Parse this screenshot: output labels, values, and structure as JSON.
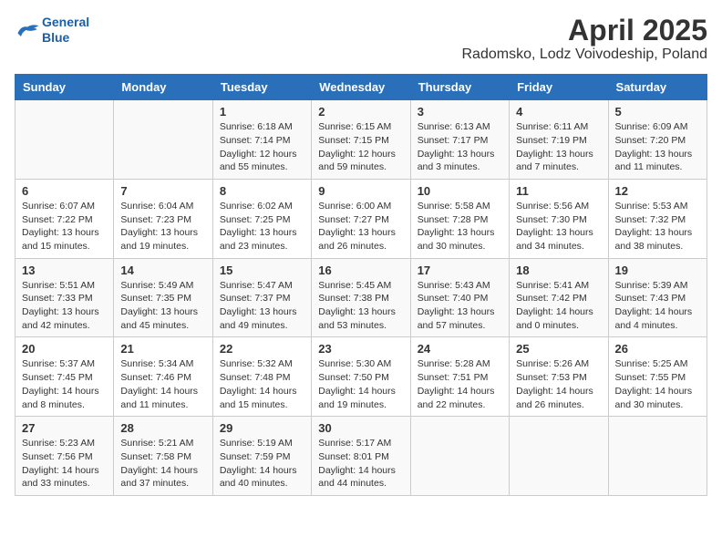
{
  "logo": {
    "line1": "General",
    "line2": "Blue"
  },
  "title": "April 2025",
  "subtitle": "Radomsko, Lodz Voivodeship, Poland",
  "days_of_week": [
    "Sunday",
    "Monday",
    "Tuesday",
    "Wednesday",
    "Thursday",
    "Friday",
    "Saturday"
  ],
  "weeks": [
    [
      {
        "day": "",
        "info": ""
      },
      {
        "day": "",
        "info": ""
      },
      {
        "day": "1",
        "info": "Sunrise: 6:18 AM\nSunset: 7:14 PM\nDaylight: 12 hours and 55 minutes."
      },
      {
        "day": "2",
        "info": "Sunrise: 6:15 AM\nSunset: 7:15 PM\nDaylight: 12 hours and 59 minutes."
      },
      {
        "day": "3",
        "info": "Sunrise: 6:13 AM\nSunset: 7:17 PM\nDaylight: 13 hours and 3 minutes."
      },
      {
        "day": "4",
        "info": "Sunrise: 6:11 AM\nSunset: 7:19 PM\nDaylight: 13 hours and 7 minutes."
      },
      {
        "day": "5",
        "info": "Sunrise: 6:09 AM\nSunset: 7:20 PM\nDaylight: 13 hours and 11 minutes."
      }
    ],
    [
      {
        "day": "6",
        "info": "Sunrise: 6:07 AM\nSunset: 7:22 PM\nDaylight: 13 hours and 15 minutes."
      },
      {
        "day": "7",
        "info": "Sunrise: 6:04 AM\nSunset: 7:23 PM\nDaylight: 13 hours and 19 minutes."
      },
      {
        "day": "8",
        "info": "Sunrise: 6:02 AM\nSunset: 7:25 PM\nDaylight: 13 hours and 23 minutes."
      },
      {
        "day": "9",
        "info": "Sunrise: 6:00 AM\nSunset: 7:27 PM\nDaylight: 13 hours and 26 minutes."
      },
      {
        "day": "10",
        "info": "Sunrise: 5:58 AM\nSunset: 7:28 PM\nDaylight: 13 hours and 30 minutes."
      },
      {
        "day": "11",
        "info": "Sunrise: 5:56 AM\nSunset: 7:30 PM\nDaylight: 13 hours and 34 minutes."
      },
      {
        "day": "12",
        "info": "Sunrise: 5:53 AM\nSunset: 7:32 PM\nDaylight: 13 hours and 38 minutes."
      }
    ],
    [
      {
        "day": "13",
        "info": "Sunrise: 5:51 AM\nSunset: 7:33 PM\nDaylight: 13 hours and 42 minutes."
      },
      {
        "day": "14",
        "info": "Sunrise: 5:49 AM\nSunset: 7:35 PM\nDaylight: 13 hours and 45 minutes."
      },
      {
        "day": "15",
        "info": "Sunrise: 5:47 AM\nSunset: 7:37 PM\nDaylight: 13 hours and 49 minutes."
      },
      {
        "day": "16",
        "info": "Sunrise: 5:45 AM\nSunset: 7:38 PM\nDaylight: 13 hours and 53 minutes."
      },
      {
        "day": "17",
        "info": "Sunrise: 5:43 AM\nSunset: 7:40 PM\nDaylight: 13 hours and 57 minutes."
      },
      {
        "day": "18",
        "info": "Sunrise: 5:41 AM\nSunset: 7:42 PM\nDaylight: 14 hours and 0 minutes."
      },
      {
        "day": "19",
        "info": "Sunrise: 5:39 AM\nSunset: 7:43 PM\nDaylight: 14 hours and 4 minutes."
      }
    ],
    [
      {
        "day": "20",
        "info": "Sunrise: 5:37 AM\nSunset: 7:45 PM\nDaylight: 14 hours and 8 minutes."
      },
      {
        "day": "21",
        "info": "Sunrise: 5:34 AM\nSunset: 7:46 PM\nDaylight: 14 hours and 11 minutes."
      },
      {
        "day": "22",
        "info": "Sunrise: 5:32 AM\nSunset: 7:48 PM\nDaylight: 14 hours and 15 minutes."
      },
      {
        "day": "23",
        "info": "Sunrise: 5:30 AM\nSunset: 7:50 PM\nDaylight: 14 hours and 19 minutes."
      },
      {
        "day": "24",
        "info": "Sunrise: 5:28 AM\nSunset: 7:51 PM\nDaylight: 14 hours and 22 minutes."
      },
      {
        "day": "25",
        "info": "Sunrise: 5:26 AM\nSunset: 7:53 PM\nDaylight: 14 hours and 26 minutes."
      },
      {
        "day": "26",
        "info": "Sunrise: 5:25 AM\nSunset: 7:55 PM\nDaylight: 14 hours and 30 minutes."
      }
    ],
    [
      {
        "day": "27",
        "info": "Sunrise: 5:23 AM\nSunset: 7:56 PM\nDaylight: 14 hours and 33 minutes."
      },
      {
        "day": "28",
        "info": "Sunrise: 5:21 AM\nSunset: 7:58 PM\nDaylight: 14 hours and 37 minutes."
      },
      {
        "day": "29",
        "info": "Sunrise: 5:19 AM\nSunset: 7:59 PM\nDaylight: 14 hours and 40 minutes."
      },
      {
        "day": "30",
        "info": "Sunrise: 5:17 AM\nSunset: 8:01 PM\nDaylight: 14 hours and 44 minutes."
      },
      {
        "day": "",
        "info": ""
      },
      {
        "day": "",
        "info": ""
      },
      {
        "day": "",
        "info": ""
      }
    ]
  ]
}
